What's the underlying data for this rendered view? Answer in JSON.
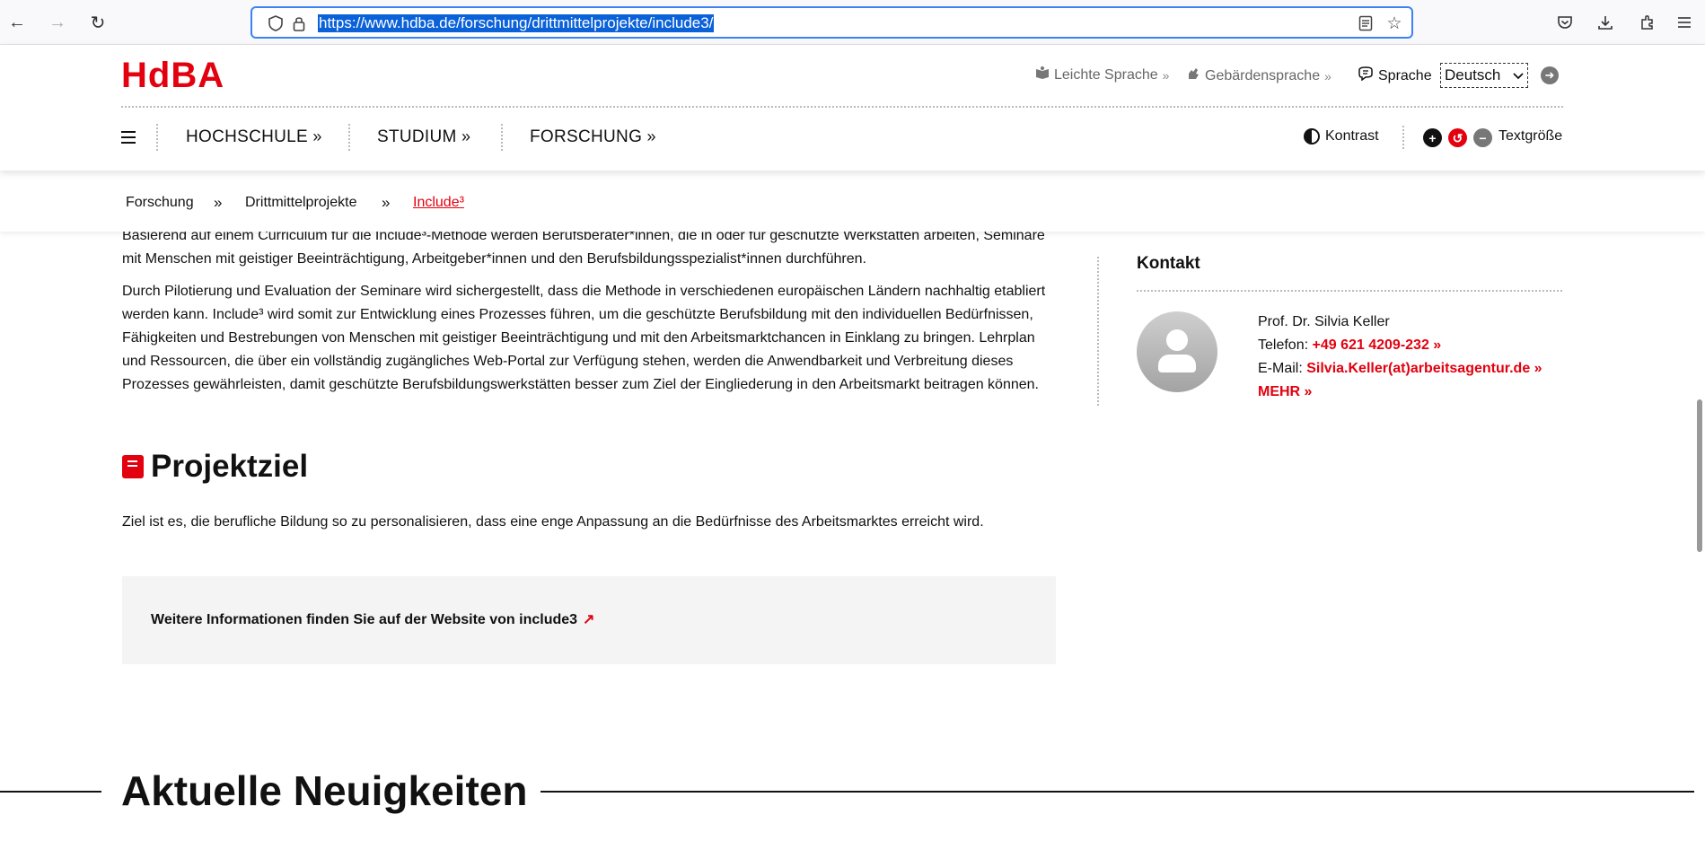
{
  "browser": {
    "url": "https://www.hdba.de/forschung/drittmittelprojekte/include3/"
  },
  "header": {
    "logo": "HdBA",
    "leichte_sprache": "Leichte Sprache",
    "gebaerdensprache": "Gebärdensprache",
    "sprache_label": "Sprache",
    "language_selected": "Deutsch",
    "nav": [
      {
        "label": "HOCHSCHULE"
      },
      {
        "label": "STUDIUM"
      },
      {
        "label": "FORSCHUNG"
      }
    ],
    "kontrast": "Kontrast",
    "textgroesse": "Textgröße"
  },
  "breadcrumb": {
    "items": [
      "Forschung",
      "Drittmittelprojekte",
      "Include³"
    ],
    "separator": "»"
  },
  "main": {
    "para1": "Basierend auf einem Curriculum für die Include³-Methode werden Berufsberater*innen, die in oder für geschützte Werkstätten arbeiten, Seminare mit Menschen mit geistiger Beeinträchtigung, Arbeitgeber*innen und den Berufsbildungsspezialist*innen durchführen.",
    "para2": "Durch Pilotierung und Evaluation der Seminare wird sichergestellt, dass die Methode in verschiedenen europäischen Ländern nachhaltig etabliert werden kann. Include³ wird somit zur Entwicklung eines Prozesses führen, um die geschützte Berufsbildung mit den individuellen Bedürfnissen, Fähigkeiten und Bestrebungen von Menschen mit geistiger Beeinträchtigung und mit den Arbeitsmarktchancen in Einklang zu bringen. Lehrplan und Ressourcen, die über ein vollständig zugängliches Web-Portal zur Verfügung stehen, werden die Anwendbarkeit und Verbreitung dieses Prozesses gewährleisten, damit geschützte Berufsbildungswerkstätten besser zum Ziel der Eingliederung in den Arbeitsmarkt beitragen können.",
    "projektziel_heading": "Projektziel",
    "projektziel_text": "Ziel ist es, die berufliche Bildung so zu personalisieren, dass eine enge Anpassung an die Bedürfnisse des Arbeitsmarktes erreicht wird.",
    "info_link": "Weitere Informationen finden Sie auf der Website von include3"
  },
  "sidebar": {
    "title": "Kontakt",
    "name": "Prof. Dr. Silvia Keller",
    "telefon_label": "Telefon:",
    "telefon": "+49 621 4209-232",
    "email_label": "E-Mail:",
    "email": "Silvia.Keller(at)arbeitsagentur.de",
    "mehr": "MEHR"
  },
  "news": {
    "title": "Aktuelle Neuigkeiten"
  },
  "colors": {
    "brand": "#e3000f",
    "url_highlight": "#0a61d8"
  }
}
